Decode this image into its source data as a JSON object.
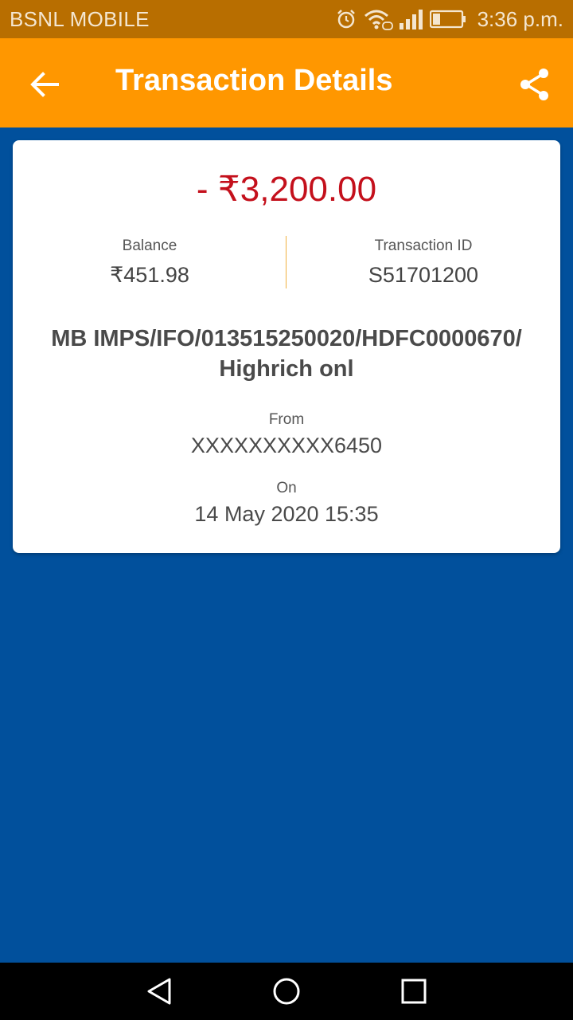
{
  "status_bar": {
    "carrier": "BSNL MOBILE",
    "time": "3:36 p.m.",
    "icons": [
      "alarm-icon",
      "wifi-icon",
      "signal-icon",
      "battery-icon"
    ]
  },
  "app_bar": {
    "title": "Transaction Details",
    "back_icon": "arrow-left-icon",
    "share_icon": "share-icon",
    "color": "#ff9700"
  },
  "transaction": {
    "amount": "- ₹3,200.00",
    "amount_color": "#c4101c",
    "balance_label": "Balance",
    "balance_value": "₹451.98",
    "txn_id_label": "Transaction ID",
    "txn_id_value": "S51701200",
    "description": "MB IMPS/IFO/013515250020/HDFC0000670/ Highrich onl",
    "from_label": "From",
    "from_value": "XXXXXXXXXX6450",
    "on_label": "On",
    "on_value": "14 May 2020 15:35"
  },
  "nav_bar": {
    "icons": [
      "back-triangle-icon",
      "home-circle-icon",
      "recents-square-icon"
    ]
  },
  "colors": {
    "background": "#01509c",
    "status_bar": "#b86e00"
  }
}
